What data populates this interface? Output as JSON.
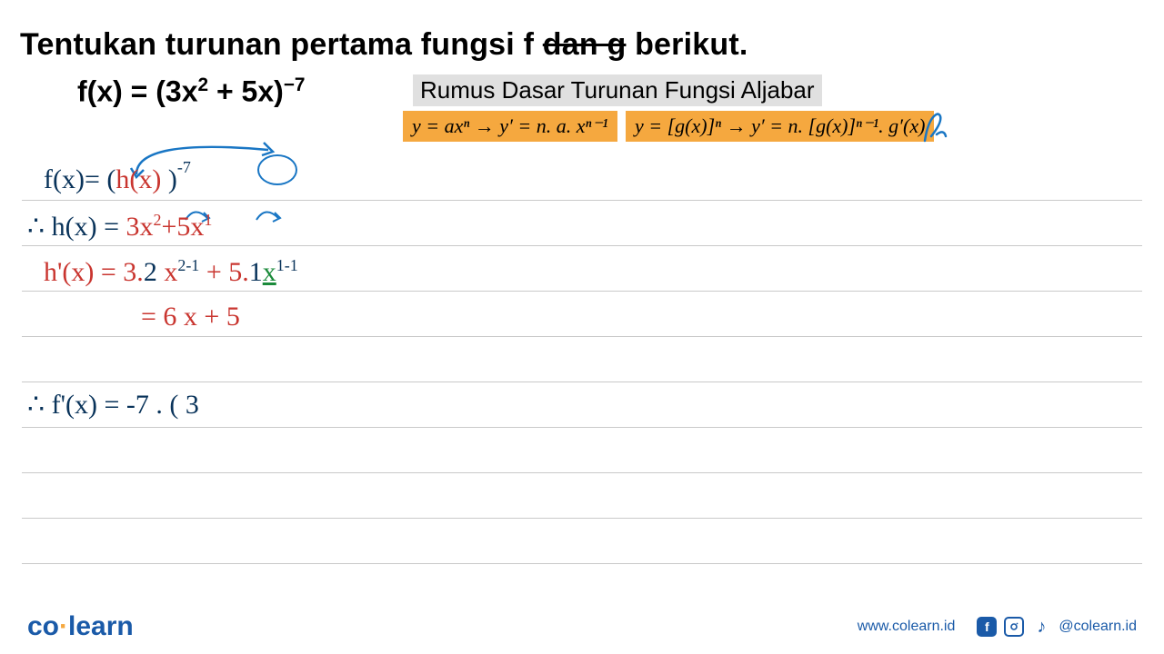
{
  "title_parts": {
    "pre": "Tentukan turunan pertama fungsi f ",
    "strike": "dan g",
    "post": " berikut."
  },
  "fx": {
    "lhs": "f(x) = (3x",
    "exp1": "2",
    "mid": " + 5x)",
    "exp2": "−7"
  },
  "rumus_label": "Rumus Dasar Turunan Fungsi Aljabar",
  "formula1": "y = axⁿ → y′ = n. a. xⁿ⁻¹",
  "formula2": "y = [g(x)]ⁿ → y′ = n. [g(x)]ⁿ⁻¹. g′(x)",
  "handwriting": {
    "l1_a": "f(x)= (",
    "l1_b": "h(x)",
    "l1_c": " )",
    "l1_exp": "-7",
    "l2_a": "∴ h(x) = ",
    "l2_b": "3x",
    "l2_b_exp": "2",
    "l2_c": "+5x",
    "l2_c_exp": "1",
    "l3_a": "h'(x) = 3.",
    "l3_b": "2",
    "l3_c": " x",
    "l3_c_exp": "2-1",
    "l3_d": " + 5.",
    "l3_e": "1",
    "l3_f": "x",
    "l3_f_exp": "1-1",
    "l4": "= 6 x  +  5",
    "l5": "∴ f'(x) = -7 . ( 3"
  },
  "footer": {
    "logo_co": "co",
    "logo_learn": "learn",
    "url": "www.colearn.id",
    "handle": "@colearn.id"
  }
}
